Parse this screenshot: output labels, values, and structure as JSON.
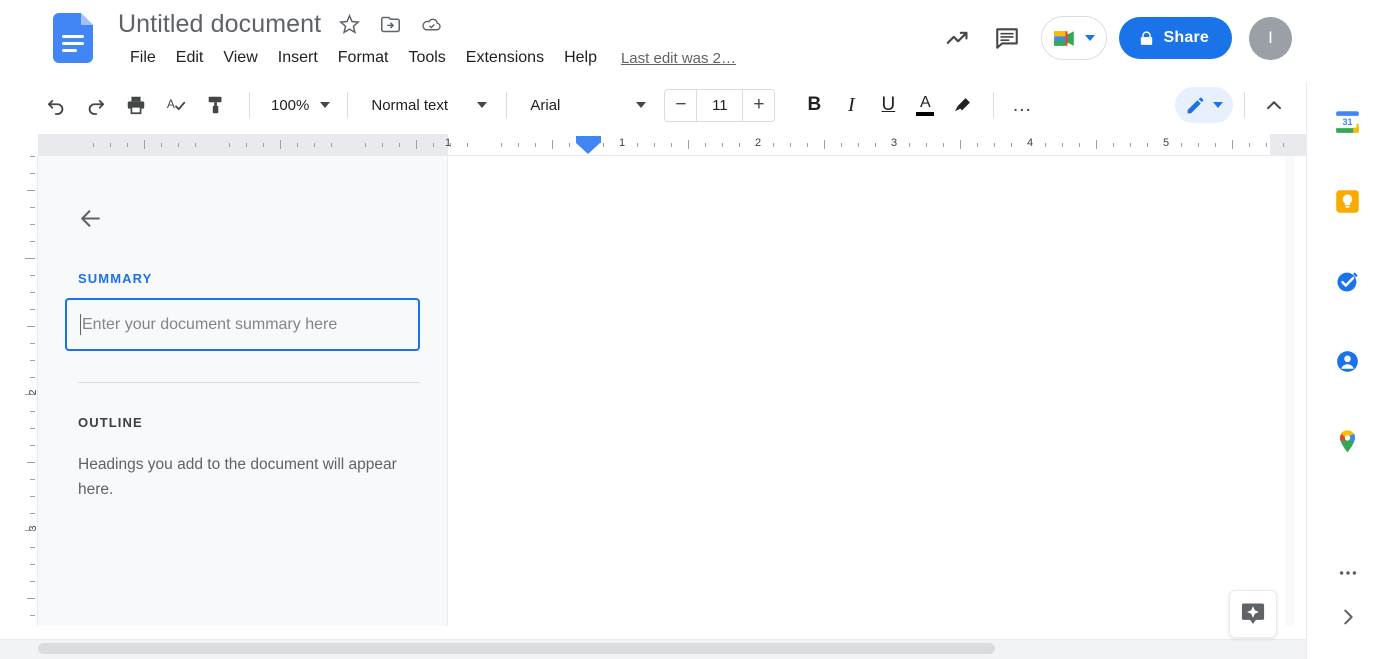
{
  "app": {
    "name": "Google Docs",
    "logo_icon": "google-docs-icon"
  },
  "header": {
    "title": "Untitled document",
    "title_icons": [
      {
        "name": "star-icon",
        "label": "Star"
      },
      {
        "name": "move-to-folder-icon",
        "label": "Move"
      },
      {
        "name": "cloud-saved-icon",
        "label": "Saved to Drive"
      }
    ],
    "menus": [
      "File",
      "Edit",
      "View",
      "Insert",
      "Format",
      "Tools",
      "Extensions",
      "Help"
    ],
    "last_edit": "Last edit was 2…",
    "right_icons": [
      {
        "name": "activity-trending-icon",
        "label": "Open activity dashboard"
      },
      {
        "name": "comment-history-icon",
        "label": "Open comment history"
      }
    ],
    "meet": {
      "icon": "google-meet-icon",
      "caret": "chevron-down-icon"
    },
    "share": {
      "label": "Share",
      "icon": "lock-icon",
      "color": "#1a73e8"
    },
    "avatar": {
      "initial": "I",
      "color": "#9aa0a6"
    }
  },
  "toolbar": {
    "left_icons": [
      {
        "name": "undo-icon",
        "label": "Undo"
      },
      {
        "name": "redo-icon",
        "label": "Redo"
      },
      {
        "name": "print-icon",
        "label": "Print"
      },
      {
        "name": "spellcheck-icon",
        "label": "Spelling and grammar check"
      },
      {
        "name": "paint-format-icon",
        "label": "Paint format"
      }
    ],
    "zoom": {
      "value": "100%",
      "caret": "chevron-down-icon"
    },
    "style": {
      "value": "Normal text",
      "caret": "chevron-down-icon"
    },
    "font": {
      "value": "Arial",
      "caret": "chevron-down-icon"
    },
    "font_size": {
      "value": "11",
      "decrease": "−",
      "increase": "+"
    },
    "format_buttons": [
      {
        "name": "bold-button",
        "label": "B"
      },
      {
        "name": "italic-button",
        "label": "I"
      },
      {
        "name": "underline-button",
        "label": "U"
      },
      {
        "name": "text-color-button",
        "label": "A"
      },
      {
        "name": "highlight-color-button",
        "label": "highlighter-icon"
      },
      {
        "name": "more-options-button",
        "label": "…"
      }
    ],
    "edit_mode": {
      "icon": "pencil-icon",
      "caret": "chevron-down-icon"
    },
    "collapse": {
      "icon": "chevron-up-icon",
      "label": "Hide the menus"
    }
  },
  "ruler": {
    "horizontal_numbers": [
      "1",
      "1",
      "2",
      "3",
      "4",
      "5"
    ],
    "vertical_numbers": [
      "2",
      "3"
    ],
    "indent_marker": "indent-marker-icon"
  },
  "outline_panel": {
    "back": {
      "icon": "arrow-back-icon",
      "label": "Close document outline"
    },
    "summary": {
      "label": "SUMMARY",
      "placeholder": "Enter your document summary here",
      "value": "",
      "focused": true,
      "accent_color": "#1a73e8"
    },
    "outline": {
      "label": "OUTLINE",
      "empty_message": "Headings you add to the document will appear here."
    }
  },
  "document": {
    "page_background": "#ffffff",
    "content": ""
  },
  "fab": {
    "icon": "smart-comment-icon",
    "label": "Show editing suggestions"
  },
  "side_rail": {
    "items": [
      {
        "name": "google-calendar-icon",
        "label": "Calendar",
        "badge": "31"
      },
      {
        "name": "google-keep-icon",
        "label": "Keep"
      },
      {
        "name": "google-tasks-icon",
        "label": "Tasks"
      },
      {
        "name": "google-contacts-icon",
        "label": "Contacts"
      },
      {
        "name": "google-maps-icon",
        "label": "Maps"
      }
    ],
    "more": {
      "icon": "more-addons-icon",
      "label": "Get add-ons"
    },
    "expand": {
      "icon": "chevron-right-icon",
      "label": "Hide side panel"
    }
  },
  "scrollbars": {
    "vertical": {
      "name": "vertical-scrollbar"
    },
    "horizontal": {
      "name": "horizontal-scrollbar"
    }
  }
}
